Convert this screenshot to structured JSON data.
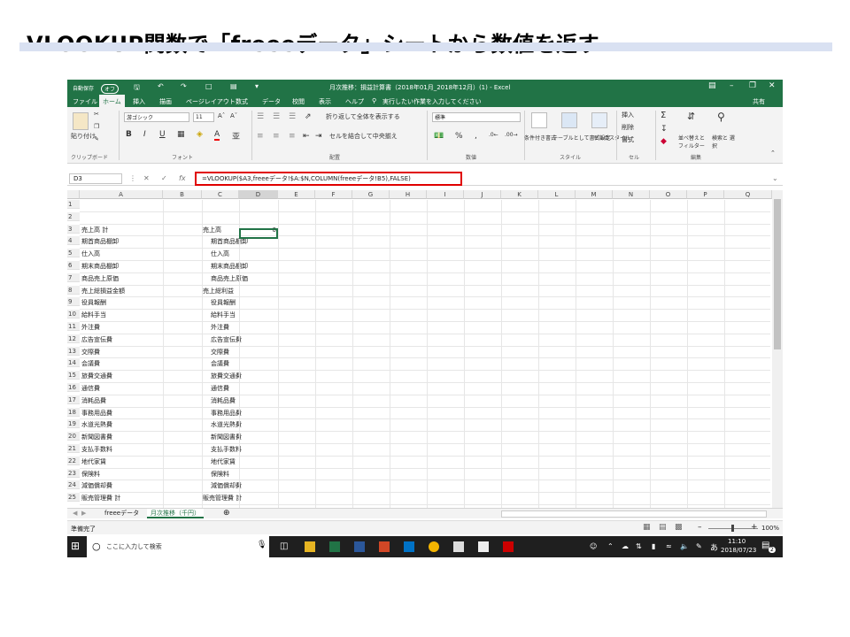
{
  "slide": {
    "title": "VLOOKUP関数で「freeeデータ」シートから数値を返す"
  },
  "excel": {
    "window_title": "月次推移：損益計算書（2018年01月_2018年12月）(1) - Excel",
    "autosave_label": "自動保存",
    "autosave_state": "オフ",
    "ribbon_tabs": [
      "ファイル",
      "ホーム",
      "挿入",
      "描画",
      "ページレイアウト",
      "数式",
      "データ",
      "校閲",
      "表示",
      "ヘルプ"
    ],
    "tell_me": "実行したい作業を入力してください",
    "share": "共有",
    "ribbon": {
      "paste": "貼り付け",
      "clipboard": "クリップボード",
      "font_name": "游ゴシック",
      "font_size": "11",
      "font_group": "フォント",
      "wrap_text": "折り返して全体を表示する",
      "merge_center": "セルを結合して中央揃え",
      "alignment_group": "配置",
      "number_format": "標準",
      "number_group": "数値",
      "cond_format": "条件付き書式",
      "format_table": "テーブルとして書式設定",
      "cell_style": "セルのスタイル",
      "styles_group": "スタイル",
      "insert": "挿入",
      "delete": "削除",
      "format": "書式",
      "cells_group": "セル",
      "sort_filter": "並べ替えと フィルター",
      "find_select": "検索と 選択",
      "editing_group": "編集"
    },
    "name_box": "D3",
    "formula": "=VLOOKUP($A3,freeeデータ!$A:$N,COLUMN(freeeデータ!B5),FALSE)",
    "columns": [
      "A",
      "B",
      "C",
      "D",
      "E",
      "F",
      "G",
      "H",
      "I",
      "J",
      "K",
      "L",
      "M",
      "N",
      "O",
      "P",
      "Q"
    ],
    "rows": [
      {
        "n": "1",
        "a": "",
        "c": "",
        "d": ""
      },
      {
        "n": "2",
        "a": "",
        "c": "",
        "d": ""
      },
      {
        "n": "3",
        "a": "売上高 計",
        "c": "売上高",
        "d": "0"
      },
      {
        "n": "4",
        "a": "期首商品棚卸",
        "c": "期首商品棚卸",
        "d": ""
      },
      {
        "n": "5",
        "a": "仕入高",
        "c": "仕入高",
        "d": ""
      },
      {
        "n": "6",
        "a": "期末商品棚卸",
        "c": "期末商品棚卸",
        "d": ""
      },
      {
        "n": "7",
        "a": "商品売上原価",
        "c": "商品売上原価",
        "d": ""
      },
      {
        "n": "8",
        "a": "売上総損益金額",
        "c": "売上総利益",
        "d": ""
      },
      {
        "n": "9",
        "a": "役員報酬",
        "c": "役員報酬",
        "d": ""
      },
      {
        "n": "10",
        "a": "給料手当",
        "c": "給料手当",
        "d": ""
      },
      {
        "n": "11",
        "a": "外注費",
        "c": "外注費",
        "d": ""
      },
      {
        "n": "12",
        "a": "広告宣伝費",
        "c": "広告宣伝費",
        "d": ""
      },
      {
        "n": "13",
        "a": "交際費",
        "c": "交際費",
        "d": ""
      },
      {
        "n": "14",
        "a": "会議費",
        "c": "会議費",
        "d": ""
      },
      {
        "n": "15",
        "a": "旅費交通費",
        "c": "旅費交通費",
        "d": ""
      },
      {
        "n": "16",
        "a": "通信費",
        "c": "通信費",
        "d": ""
      },
      {
        "n": "17",
        "a": "消耗品費",
        "c": "消耗品費",
        "d": ""
      },
      {
        "n": "18",
        "a": "事務用品費",
        "c": "事務用品費",
        "d": ""
      },
      {
        "n": "19",
        "a": "水道光熱費",
        "c": "水道光熱費",
        "d": ""
      },
      {
        "n": "20",
        "a": "新聞図書費",
        "c": "新聞図書費",
        "d": ""
      },
      {
        "n": "21",
        "a": "支払手数料",
        "c": "支払手数料",
        "d": ""
      },
      {
        "n": "22",
        "a": "地代家賃",
        "c": "地代家賃",
        "d": ""
      },
      {
        "n": "23",
        "a": "保険料",
        "c": "保険料",
        "d": ""
      },
      {
        "n": "24",
        "a": "減価償却費",
        "c": "減価償却費",
        "d": ""
      },
      {
        "n": "25",
        "a": "販売管理費 計",
        "c": "販売管理費 計",
        "d": ""
      }
    ],
    "sheet_tabs": [
      "freeeデータ",
      "月次推移（千円）"
    ],
    "status_left": "準備完了",
    "zoom": "100%"
  },
  "taskbar": {
    "search": "ここに入力して検索",
    "ime": "あ",
    "time": "11:10",
    "date": "2018/07/23",
    "notifications": "2"
  },
  "colors": {
    "excel_green": "#217346",
    "highlight_red": "#e00000",
    "title_band": "#d9e1f2"
  }
}
